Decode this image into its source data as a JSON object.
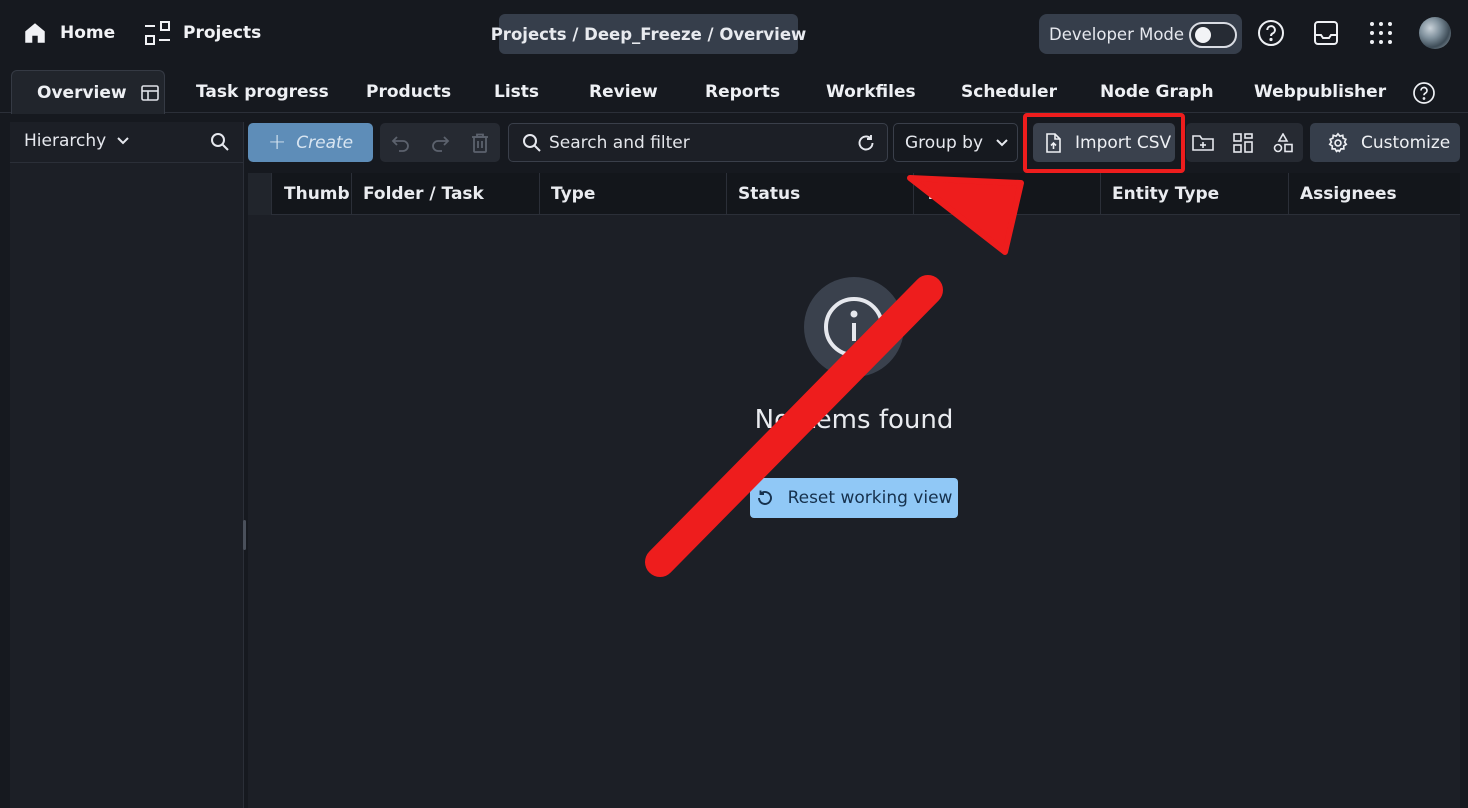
{
  "topbar": {
    "home_label": "Home",
    "projects_label": "Projects",
    "breadcrumb": "Projects / Deep_Freeze / Overview",
    "developer_mode_label": "Developer Mode",
    "developer_mode_on": false,
    "icons": [
      "home-icon",
      "projects-icon",
      "help-icon",
      "inbox-icon",
      "apps-grid-icon",
      "avatar"
    ]
  },
  "tabs": [
    {
      "label": "Overview",
      "active": true
    },
    {
      "label": "Task progress"
    },
    {
      "label": "Products"
    },
    {
      "label": "Lists"
    },
    {
      "label": "Review"
    },
    {
      "label": "Reports"
    },
    {
      "label": "Workfiles"
    },
    {
      "label": "Scheduler"
    },
    {
      "label": "Node Graph"
    },
    {
      "label": "Webpublisher"
    }
  ],
  "sidebar": {
    "hierarchy_label": "Hierarchy"
  },
  "toolbar": {
    "create_label": "Create",
    "search_placeholder": "Search and filter",
    "group_by_label": "Group by",
    "import_csv_label": "Import CSV",
    "customize_label": "Customize"
  },
  "table": {
    "columns": [
      "Thumbnail",
      "Folder / Task",
      "Type",
      "Status",
      "Tags",
      "Entity Type",
      "Assignees"
    ]
  },
  "empty_state": {
    "message": "No items found",
    "reset_label": "Reset working view"
  },
  "colors": {
    "background": "#16191f",
    "create_button": "#5e8db8",
    "reset_button": "#90c8f6",
    "annotation_red": "#ee1d1d"
  }
}
